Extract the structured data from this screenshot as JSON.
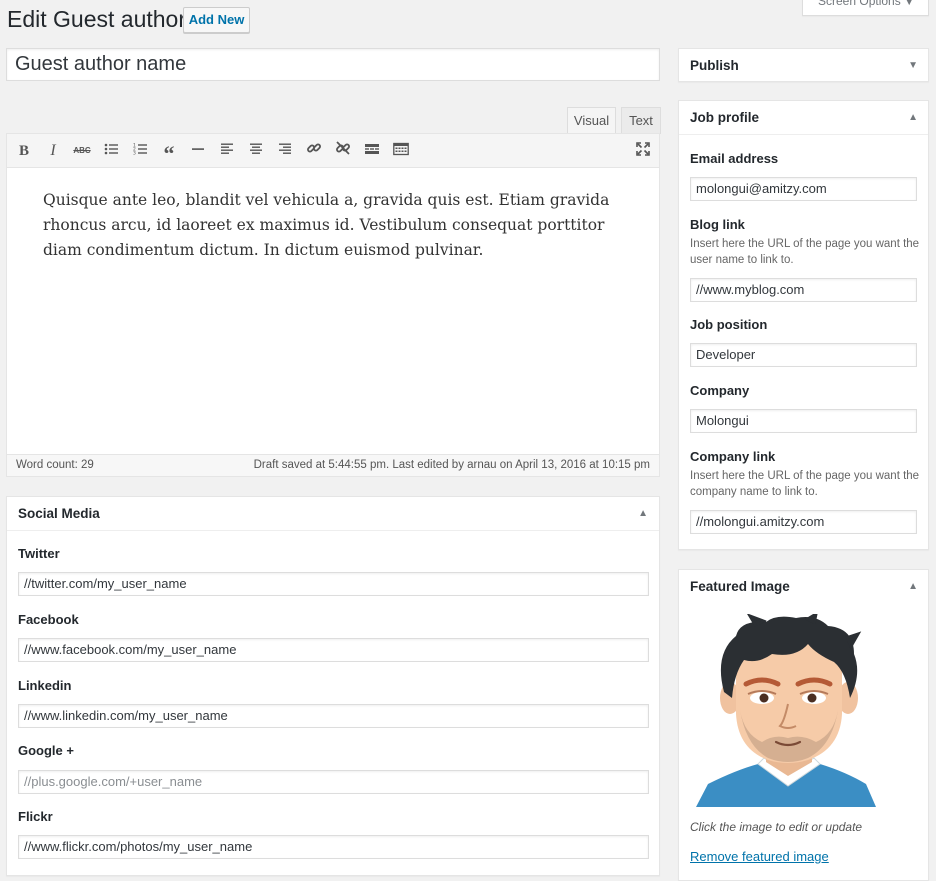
{
  "header": {
    "title": "Edit Guest author",
    "add_new_label": "Add New",
    "screen_options_label": "Screen Options"
  },
  "post_title": {
    "placeholder": "Guest author name"
  },
  "editor": {
    "tabs": {
      "visual": "Visual",
      "text": "Text"
    },
    "active_tab": "Visual",
    "toolbar_icons": [
      "bold-icon",
      "italic-icon",
      "strikethrough-icon",
      "bullet-list-icon",
      "numbered-list-icon",
      "blockquote-icon",
      "horizontal-line-icon",
      "align-left-icon",
      "align-center-icon",
      "align-right-icon",
      "link-icon",
      "unlink-icon",
      "read-more-icon",
      "toolbar-toggle-icon",
      "fullscreen-icon"
    ],
    "content": "Quisque ante leo, blandit vel vehicula a, gravida quis est. Etiam gravida rhoncus arcu, id laoreet ex maximus id. Vestibulum consequat porttitor diam condimentum dictum. In dictum euismod pulvinar.",
    "word_count": "Word count: 29",
    "draft_status": "Draft saved at 5:44:55 pm. Last edited by arnau on April 13, 2016 at 10:15 pm"
  },
  "social_media": {
    "title": "Social Media",
    "twitter": {
      "label": "Twitter",
      "value": "//twitter.com/my_user_name"
    },
    "facebook": {
      "label": "Facebook",
      "value": "//www.facebook.com/my_user_name"
    },
    "linkedin": {
      "label": "Linkedin",
      "value": "//www.linkedin.com/my_user_name"
    },
    "google": {
      "label": "Google +",
      "placeholder": "//plus.google.com/+user_name"
    },
    "flickr": {
      "label": "Flickr",
      "value": "//www.flickr.com/photos/my_user_name"
    }
  },
  "publish": {
    "title": "Publish"
  },
  "job_profile": {
    "title": "Job profile",
    "email": {
      "label": "Email address",
      "value": "molongui@amitzy.com"
    },
    "blog": {
      "label": "Blog link",
      "description": "Insert here the URL of the page you want the user name to link to.",
      "value": "//www.myblog.com"
    },
    "position": {
      "label": "Job position",
      "value": "Developer"
    },
    "company": {
      "label": "Company",
      "value": "Molongui"
    },
    "company_link": {
      "label": "Company link",
      "description": "Insert here the URL of the page you want the company name to link to.",
      "value": "//molongui.amitzy.com"
    }
  },
  "featured_image": {
    "title": "Featured Image",
    "caption": "Click the image to edit or update",
    "remove_label": "Remove featured image"
  },
  "colors": {
    "link": "#0073aa",
    "background": "#f1f1f1"
  }
}
